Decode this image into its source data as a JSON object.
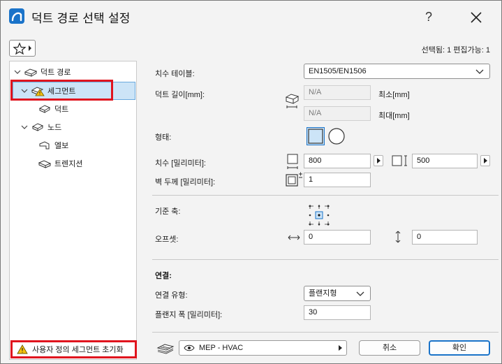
{
  "window": {
    "title": "덕트 경로 선택 설정",
    "help": "?"
  },
  "toolbar": {
    "selection_info": "선택됨: 1 편집가능: 1"
  },
  "tree": {
    "items": [
      {
        "label": "덕트 경로"
      },
      {
        "label": "세그먼트"
      },
      {
        "label": "덕트"
      },
      {
        "label": "노드"
      },
      {
        "label": "엘보"
      },
      {
        "label": "트렌지션"
      }
    ],
    "reset_label": "사용자 정의 세그먼트 초기화"
  },
  "settings": {
    "size_table_label": "치수 테이블:",
    "size_table_value": "EN1505/EN1506",
    "duct_length_label": "덕트 길이[mm]:",
    "length_min_value": "N/A",
    "length_min_label": "최소[mm]",
    "length_max_value": "N/A",
    "length_max_label": "최대[mm]",
    "shape_label": "형태:",
    "dimension_label": "치수 [밀리미터]:",
    "width_value": "800",
    "height_value": "500",
    "wall_label": "벽 두께 [밀리미터]:",
    "wall_value": "1",
    "ref_axis_label": "기준 축:",
    "offset_label": "오프셋:",
    "offset_x_value": "0",
    "offset_y_value": "0",
    "connection_heading": "연결:",
    "conn_type_label": "연결 유형:",
    "conn_type_value": "플랜지형",
    "flange_width_label": "플랜지 폭 [밀리미터]:",
    "flange_width_value": "30"
  },
  "footer": {
    "layer_value": "MEP - HVAC",
    "cancel_label": "취소",
    "ok_label": "확인"
  },
  "colors": {
    "accent": "#1a73c9",
    "highlight": "#e0141e",
    "selection": "#cce4f7"
  }
}
